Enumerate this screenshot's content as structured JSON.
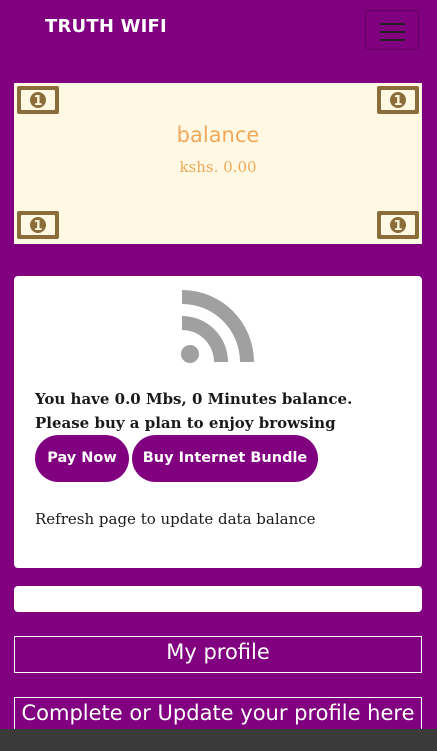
{
  "navbar": {
    "brand": "TRUTH WIFI",
    "menu_icon": "hamburger-menu-icon"
  },
  "balance_card": {
    "title": "balance",
    "amount": "kshs. 0.00",
    "corner_icon": "money-bill-icon",
    "colors": {
      "background": "#fff8e2",
      "text": "#f0a95c",
      "icon": "#8a6d3b"
    }
  },
  "info_card": {
    "icon": "rss-icon",
    "line1": "You have 0.0 Mbs, 0 Minutes balance.",
    "line2": "Please buy a plan to enjoy browsing",
    "pay_now_label": "Pay Now",
    "buy_bundle_label": "Buy Internet Bundle",
    "refresh_note": "Refresh page to update data balance"
  },
  "profile": {
    "my_profile_label": "My profile",
    "complete_profile_label": "Complete or Update your profile here"
  },
  "colors": {
    "brand": "#800080",
    "card": "#ffffff"
  }
}
